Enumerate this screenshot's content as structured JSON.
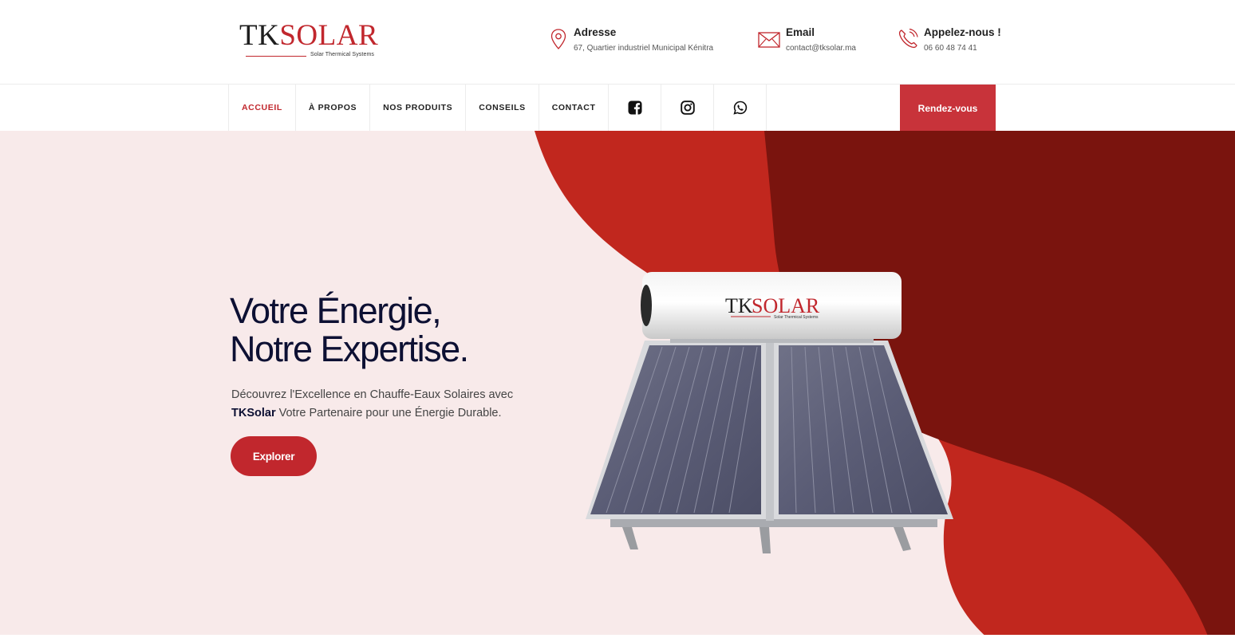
{
  "brand": {
    "name_part1": "TK",
    "name_part2": "SOLAR",
    "tagline": "Solar Thermical Systems",
    "primary_color": "#c1272d",
    "dark_red": "#7a140e",
    "navy": "#0d1033"
  },
  "contact": {
    "address": {
      "icon": "location-pin-icon",
      "title": "Adresse",
      "value": "67, Quartier industriel Municipal Kénitra"
    },
    "email": {
      "icon": "envelope-icon",
      "title": "Email",
      "value": "contact@tksolar.ma"
    },
    "phone": {
      "icon": "phone-icon",
      "title": "Appelez-nous !",
      "value": "06 60 48 74 41"
    }
  },
  "nav": {
    "items": [
      {
        "label": "ACCUEIL",
        "active": true
      },
      {
        "label": "À PROPOS",
        "active": false
      },
      {
        "label": "NOS PRODUITS",
        "active": false
      },
      {
        "label": "CONSEILS",
        "active": false
      },
      {
        "label": "CONTACT",
        "active": false
      }
    ],
    "social": [
      "facebook-icon",
      "instagram-icon",
      "whatsapp-icon"
    ],
    "cta_label": "Rendez-vous"
  },
  "hero": {
    "title_line1": "Votre Énergie,",
    "title_line2": "Notre Expertise.",
    "subtitle_part1": "Découvrez l'Excellence en Chauffe-Eaux Solaires avec",
    "subtitle_bold": "TKSolar",
    "subtitle_part2": " Votre Partenaire pour une Énergie Durable.",
    "button_label": "Explorer",
    "product_tank_brand1": "TK",
    "product_tank_brand2": "SOLAR",
    "product_tank_tagline": "Solar Thermical Systems"
  }
}
